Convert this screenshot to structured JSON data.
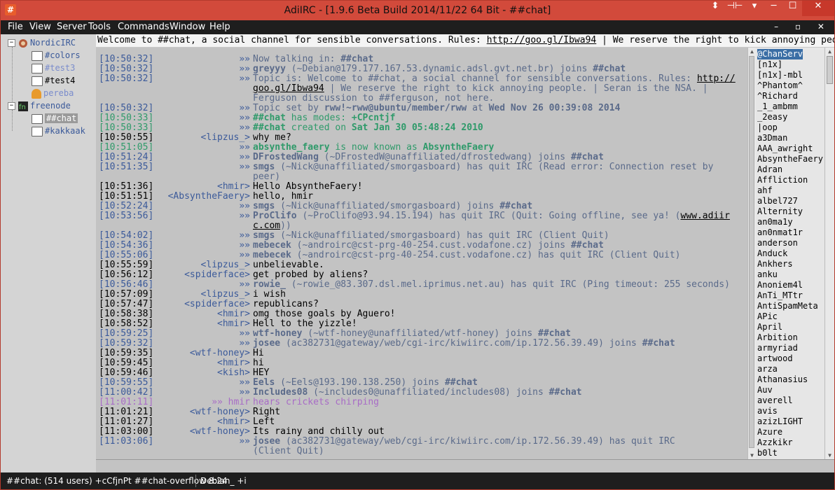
{
  "window": {
    "title": "AdiIRC - [1.9.6 Beta Build 2014/11/22 64 Bit - ##chat]",
    "app_icon": "#",
    "controls": {
      "extra1": "⬍",
      "extra2": "⊣⊢",
      "extra3": "▾",
      "minimize": "─",
      "maximize": "☐",
      "close": "✕"
    }
  },
  "menubar": {
    "items": [
      "File",
      "View",
      "Server",
      "Tools",
      "Commands",
      "Window",
      "Help"
    ],
    "mdi_controls": "– ▫ ✕"
  },
  "tree": {
    "networks": [
      {
        "name": "NordicIRC",
        "expand": "−",
        "icon": "nordicirc-network-icon",
        "children": [
          {
            "name": "#colors",
            "type": "channel",
            "color": "#3b5a9a"
          },
          {
            "name": "#test3",
            "type": "channel",
            "color": "#7a8ccc"
          },
          {
            "name": "#test4",
            "type": "channel",
            "color": "#000000"
          },
          {
            "name": "pereba",
            "type": "query",
            "color": "#7a8ccc"
          }
        ]
      },
      {
        "name": "freenode",
        "expand": "−",
        "icon": "freenode-network-icon",
        "children": [
          {
            "name": "##chat",
            "type": "channel",
            "selected": true
          },
          {
            "name": "#kakkaak",
            "type": "channel",
            "color": "#3b5a9a"
          }
        ]
      }
    ]
  },
  "topic": {
    "pre": "Welcome to ##chat, a social channel for sensible conversations. Rules: ",
    "link": "http://goo.gl/Ibwa94",
    "post": " | We reserve the right to kick annoying people. | Seran is the NSA."
  },
  "chat": {
    "lines": [
      {
        "ts": "[10:50:32]",
        "tsc": "c-blue",
        "nick": "»»",
        "parts": [
          [
            "Now talking in: ",
            "c-gray"
          ],
          [
            "##chat",
            "c-gray bold"
          ]
        ]
      },
      {
        "ts": "[10:50:32]",
        "tsc": "c-blue",
        "nick": "»»",
        "parts": [
          [
            "greyyy",
            "c-gray bold"
          ],
          [
            " (~Debian@179.177.167.53.dynamic.adsl.gvt.net.br) joins ",
            "c-gray"
          ],
          [
            "##chat",
            "c-gray bold"
          ]
        ]
      },
      {
        "ts": "[10:50:32]",
        "tsc": "c-blue",
        "nick": "»»",
        "parts": [
          [
            "Topic is: Welcome to ##chat, a social channel for sensible conversations. Rules: ",
            "c-gray"
          ],
          [
            "http://",
            "u"
          ]
        ]
      },
      {
        "ts": "",
        "nick": "",
        "parts": [
          [
            "goo.gl/Ibwa94",
            "u"
          ],
          [
            " | We reserve the right to kick annoying people. | Seran is the NSA. |",
            "c-gray"
          ]
        ]
      },
      {
        "ts": "",
        "nick": "",
        "parts": [
          [
            "Ferguson discussion to ##ferguson, not here.",
            "c-gray"
          ]
        ]
      },
      {
        "ts": "[10:50:32]",
        "tsc": "c-blue",
        "nick": "»»",
        "parts": [
          [
            "Topic set by ",
            "c-gray"
          ],
          [
            "rww!~rww@ubuntu/member/rww",
            "c-gray bold"
          ],
          [
            " at ",
            "c-gray"
          ],
          [
            "Wed Nov 26 00:39:08 2014",
            "c-gray bold"
          ]
        ]
      },
      {
        "ts": "[10:50:33]",
        "tsc": "c-green",
        "nick": "»»",
        "parts": [
          [
            "##chat",
            "c-green bold"
          ],
          [
            " has modes: ",
            "c-green"
          ],
          [
            "+CPcntjf",
            "c-green bold"
          ]
        ]
      },
      {
        "ts": "[10:50:33]",
        "tsc": "c-green",
        "nick": "»»",
        "parts": [
          [
            "##chat",
            "c-green bold"
          ],
          [
            " created on ",
            "c-green"
          ],
          [
            "Sat Jan 30 05:48:24 2010",
            "c-green bold"
          ]
        ]
      },
      {
        "ts": "[10:50:55]",
        "tsc": "c-black",
        "nick": "<lipzus_>",
        "nickc": "c-blue",
        "parts": [
          [
            "why me?",
            "c-black"
          ]
        ]
      },
      {
        "ts": "[10:51:05]",
        "tsc": "c-green",
        "nick": "»»",
        "parts": [
          [
            "absynthe_faery",
            "c-green bold"
          ],
          [
            " is now known as ",
            "c-green"
          ],
          [
            "AbsyntheFaery",
            "c-green bold"
          ]
        ]
      },
      {
        "ts": "[10:51:24]",
        "tsc": "c-blue",
        "nick": "»»",
        "parts": [
          [
            "DFrostedWang",
            "c-gray bold"
          ],
          [
            " (~DFrostedW@unaffiliated/dfrostedwang) joins ",
            "c-gray"
          ],
          [
            "##chat",
            "c-gray bold"
          ]
        ]
      },
      {
        "ts": "[10:51:35]",
        "tsc": "c-blue",
        "nick": "»»",
        "parts": [
          [
            "smgs",
            "c-gray bold"
          ],
          [
            " (~Nick@unaffiliated/smorgasboard) has quit IRC (Read error: Connection reset by",
            "c-gray"
          ]
        ]
      },
      {
        "ts": "",
        "nick": "",
        "parts": [
          [
            "peer)",
            "c-gray"
          ]
        ]
      },
      {
        "ts": "[10:51:36]",
        "tsc": "c-black",
        "nick": "<hmir>",
        "nickc": "c-blue",
        "parts": [
          [
            "Hello AbsyntheFaery!",
            "c-black"
          ]
        ]
      },
      {
        "ts": "[10:51:51]",
        "tsc": "c-black",
        "nick": "<AbsyntheFaery>",
        "nickc": "c-blue",
        "parts": [
          [
            "hello, hmir",
            "c-black"
          ]
        ]
      },
      {
        "ts": "[10:52:24]",
        "tsc": "c-blue",
        "nick": "»»",
        "parts": [
          [
            "smgs",
            "c-gray bold"
          ],
          [
            " (~Nick@unaffiliated/smorgasboard) joins ",
            "c-gray"
          ],
          [
            "##chat",
            "c-gray bold"
          ]
        ]
      },
      {
        "ts": "[10:53:56]",
        "tsc": "c-blue",
        "nick": "»»",
        "parts": [
          [
            "ProClifo",
            "c-gray bold"
          ],
          [
            " (~ProClifo@93.94.15.194) has quit IRC (Quit: Going offline, see ya! (",
            "c-gray"
          ],
          [
            "www.adiir",
            "u"
          ]
        ]
      },
      {
        "ts": "",
        "nick": "",
        "parts": [
          [
            "c.com",
            "u"
          ],
          [
            "))",
            "c-gray"
          ]
        ]
      },
      {
        "ts": "[10:54:02]",
        "tsc": "c-blue",
        "nick": "»»",
        "parts": [
          [
            "smgs",
            "c-gray bold"
          ],
          [
            " (~Nick@unaffiliated/smorgasboard) has quit IRC (Client Quit)",
            "c-gray"
          ]
        ]
      },
      {
        "ts": "[10:54:36]",
        "tsc": "c-blue",
        "nick": "»»",
        "parts": [
          [
            "mebecek",
            "c-gray bold"
          ],
          [
            " (~androirc@cst-prg-40-254.cust.vodafone.cz) joins ",
            "c-gray"
          ],
          [
            "##chat",
            "c-gray bold"
          ]
        ]
      },
      {
        "ts": "[10:55:06]",
        "tsc": "c-blue",
        "nick": "»»",
        "parts": [
          [
            "mebecek",
            "c-gray bold"
          ],
          [
            " (~androirc@cst-prg-40-254.cust.vodafone.cz) has quit IRC (Client Quit)",
            "c-gray"
          ]
        ]
      },
      {
        "ts": "[10:55:59]",
        "tsc": "c-black",
        "nick": "<lipzus_>",
        "nickc": "c-blue",
        "parts": [
          [
            "unbelievable.",
            "c-black"
          ]
        ]
      },
      {
        "ts": "[10:56:12]",
        "tsc": "c-black",
        "nick": "<spiderface>",
        "nickc": "c-blue",
        "parts": [
          [
            "get probed by aliens?",
            "c-black"
          ]
        ]
      },
      {
        "ts": "[10:56:46]",
        "tsc": "c-blue",
        "nick": "»»",
        "parts": [
          [
            "rowie_",
            "c-gray bold"
          ],
          [
            " (~rowie_@83.307.dsl.mel.iprimus.net.au) has quit IRC (Ping timeout: 255 seconds)",
            "c-gray"
          ]
        ]
      },
      {
        "ts": "[10:57:09]",
        "tsc": "c-black",
        "nick": "<lipzus_>",
        "nickc": "c-blue",
        "parts": [
          [
            "i wish",
            "c-black"
          ]
        ]
      },
      {
        "ts": "[10:57:47]",
        "tsc": "c-black",
        "nick": "<spiderface>",
        "nickc": "c-blue",
        "parts": [
          [
            "republicans?",
            "c-black"
          ]
        ]
      },
      {
        "ts": "[10:58:38]",
        "tsc": "c-black",
        "nick": "<hmir>",
        "nickc": "c-blue",
        "parts": [
          [
            " omg those goals by Aguero!",
            "c-black"
          ]
        ]
      },
      {
        "ts": "[10:58:52]",
        "tsc": "c-black",
        "nick": "<hmir>",
        "nickc": "c-blue",
        "parts": [
          [
            "Hell to the yizzle!",
            "c-black"
          ]
        ]
      },
      {
        "ts": "[10:59:25]",
        "tsc": "c-blue",
        "nick": "»»",
        "parts": [
          [
            "wtf-honey",
            "c-gray bold"
          ],
          [
            " (~wtf-honey@unaffiliated/wtf-honey) joins ",
            "c-gray"
          ],
          [
            "##chat",
            "c-gray bold"
          ]
        ]
      },
      {
        "ts": "[10:59:32]",
        "tsc": "c-blue",
        "nick": "»»",
        "parts": [
          [
            "josee",
            "c-gray bold"
          ],
          [
            " (ac382731@gateway/web/cgi-irc/kiwiirc.com/ip.172.56.39.49) joins ",
            "c-gray"
          ],
          [
            "##chat",
            "c-gray bold"
          ]
        ]
      },
      {
        "ts": "[10:59:35]",
        "tsc": "c-black",
        "nick": "<wtf-honey>",
        "nickc": "c-blue",
        "parts": [
          [
            "Hi",
            "c-black"
          ]
        ]
      },
      {
        "ts": "[10:59:45]",
        "tsc": "c-black",
        "nick": "<hmir>",
        "nickc": "c-blue",
        "parts": [
          [
            "hi",
            "c-black"
          ]
        ]
      },
      {
        "ts": "[10:59:46]",
        "tsc": "c-black",
        "nick": "<kish>",
        "nickc": "c-blue",
        "parts": [
          [
            "HEY",
            "c-black"
          ]
        ]
      },
      {
        "ts": "[10:59:55]",
        "tsc": "c-blue",
        "nick": "»»",
        "parts": [
          [
            "Eels",
            "c-gray bold"
          ],
          [
            " (~Eels@193.190.138.250) joins ",
            "c-gray"
          ],
          [
            "##chat",
            "c-gray bold"
          ]
        ]
      },
      {
        "ts": "[11:00:42]",
        "tsc": "c-blue",
        "nick": "»»",
        "parts": [
          [
            "Includes08",
            "c-gray bold"
          ],
          [
            " (~includes0@unaffiliated/includes08) joins ",
            "c-gray"
          ],
          [
            "##chat",
            "c-gray bold"
          ]
        ]
      },
      {
        "ts": "[11:01:11]",
        "tsc": "c-purple",
        "nick": "»» hmir",
        "nickc": "c-purple",
        "parts": [
          [
            "hears crickets chirping",
            "c-purple"
          ]
        ]
      },
      {
        "ts": "[11:01:21]",
        "tsc": "c-black",
        "nick": "<wtf-honey>",
        "nickc": "c-blue",
        "parts": [
          [
            "Right",
            "c-black"
          ]
        ]
      },
      {
        "ts": "[11:01:27]",
        "tsc": "c-black",
        "nick": "<hmir>",
        "nickc": "c-blue",
        "parts": [
          [
            "Left",
            "c-black"
          ]
        ]
      },
      {
        "ts": "[11:03:00]",
        "tsc": "c-black",
        "nick": "<wtf-honey>",
        "nickc": "c-blue",
        "parts": [
          [
            "Its rainy and chilly out",
            "c-black"
          ]
        ]
      },
      {
        "ts": "[11:03:06]",
        "tsc": "c-blue",
        "nick": "»»",
        "parts": [
          [
            "josee",
            "c-gray bold"
          ],
          [
            " (ac382731@gateway/web/cgi-irc/kiwiirc.com/ip.172.56.39.49) has quit IRC",
            "c-gray"
          ]
        ]
      },
      {
        "ts": "",
        "nick": "",
        "parts": [
          [
            "(Client Quit)",
            "c-gray"
          ]
        ]
      }
    ]
  },
  "nicklist": [
    "@ChanServ",
    "[n1x]",
    "[n1x]-mbl",
    "^Phantom^",
    "^Richard",
    "_1_ambmm",
    "_2easy",
    "|oop",
    "a3Dman",
    "AAA_awright",
    "AbsyntheFaery",
    "Adran",
    "Affliction",
    "ahf",
    "albel727",
    "Alternity",
    "an0ma1y",
    "an0nmat1r",
    "anderson",
    "Anduck",
    "Ankhers",
    "anku",
    "Anoniem4l",
    "AnTi_MTtr",
    "AntiSpamMeta",
    "APic",
    "April",
    "Arbition",
    "armyriad",
    "artwood",
    "arza",
    "Athanasius",
    "Auv",
    "averell",
    "avis",
    "azizLIGHT",
    "Azure",
    "Azzkikr",
    "b0lt"
  ],
  "statusbar": {
    "left": "##chat: (514 users) +cCfjnPt ##chat-overflow 8:24",
    "right": "Debian_ +i"
  }
}
